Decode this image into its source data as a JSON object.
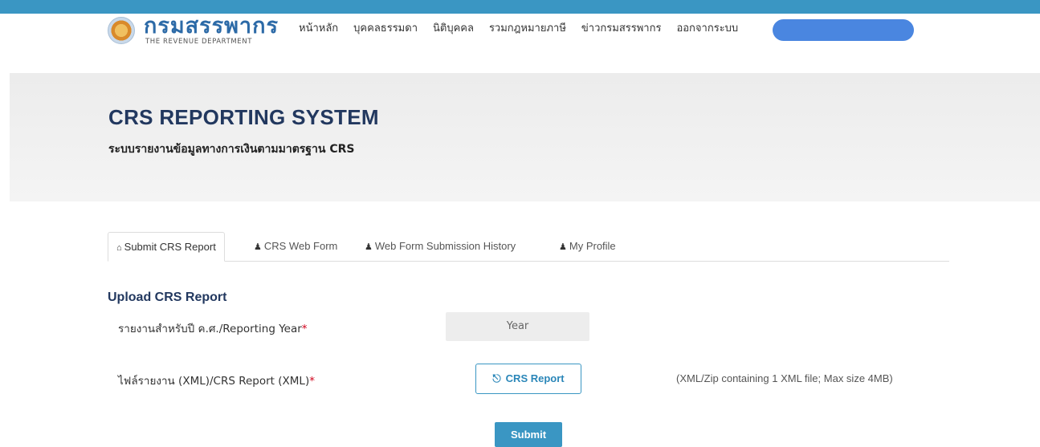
{
  "header": {
    "logo_thai": "กรมสรรพากร",
    "logo_en": "THE REVENUE DEPARTMENT",
    "nav": [
      "หน้าหลัก",
      "บุคคลธรรมดา",
      "นิติบุคคล",
      "รวมกฎหมายภาษี",
      "ข่าวกรมสรรพากร",
      "ออกจากระบบ"
    ]
  },
  "banner": {
    "title": "CRS REPORTING SYSTEM",
    "subtitle": "ระบบรายงานข้อมูลทางการเงินตามมาตรฐาน CRS"
  },
  "tabs": [
    {
      "label": "Submit CRS Report",
      "icon": "home-icon"
    },
    {
      "label": "CRS Web Form",
      "icon": "user-icon"
    },
    {
      "label": "Web Form Submission History",
      "icon": "user-icon"
    },
    {
      "label": "My Profile",
      "icon": "user-icon"
    }
  ],
  "form": {
    "section_title": "Upload CRS Report",
    "year_label": "รายงานสำหรับปี ค.ศ./Reporting Year",
    "year_placeholder": "Year",
    "file_label": "ไฟล์รายงาน (XML)/CRS Report (XML)",
    "required_mark": "*",
    "upload_label": "CRS Report",
    "file_hint": "(XML/Zip containing 1 XML file; Max size 4MB)",
    "submit_label": "Submit"
  },
  "colors": {
    "accent": "#3a96c3",
    "title": "#22385f"
  }
}
